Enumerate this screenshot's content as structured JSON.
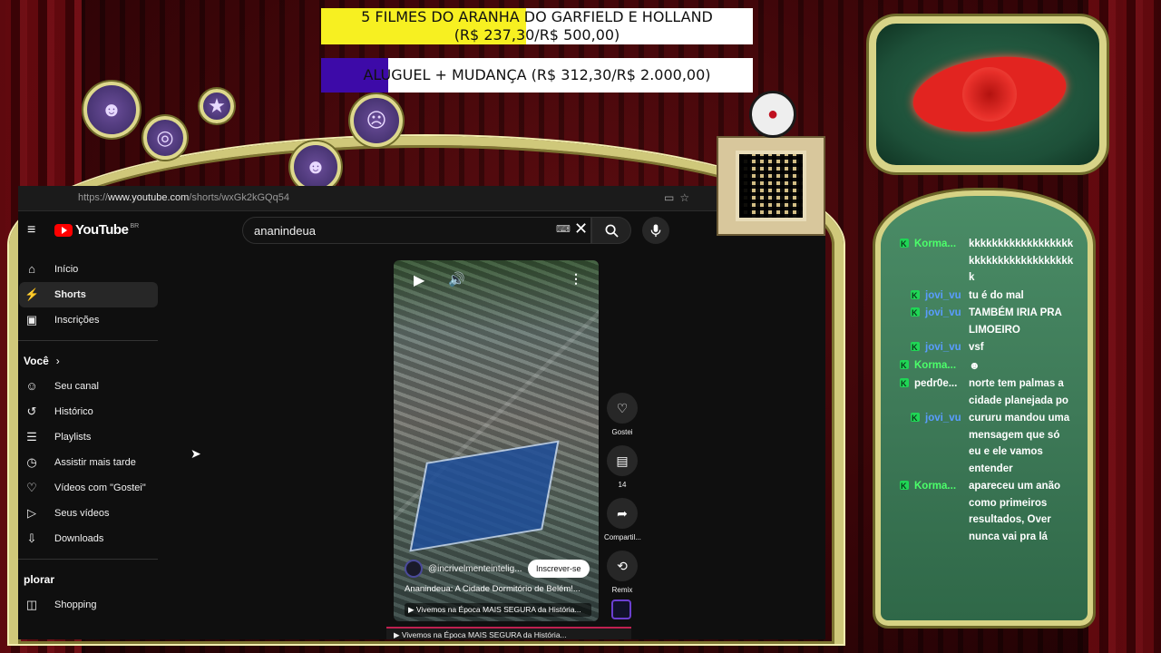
{
  "goals": [
    {
      "title": "5 FILMES DO ARANHA DO GARFIELD E HOLLAND",
      "progress": "(R$ 237,30/R$ 500,00)",
      "fill_fraction": 0.475,
      "color": "#f7f021"
    },
    {
      "title": "ALUGUEL + MUDANÇA (R$ 312,30/R$ 2.000,00)",
      "fill_fraction": 0.156,
      "color": "#3d0aa8"
    }
  ],
  "browser": {
    "url_prefix": "https://",
    "url_host": "www.youtube.com",
    "url_path": "/shorts/wxGk2kGQq54"
  },
  "youtube": {
    "logo_text": "YouTube",
    "region": "BR",
    "search_value": "ananindeua",
    "sidebar": {
      "items": [
        {
          "label": "Início",
          "icon": "home-icon",
          "active": false
        },
        {
          "label": "Shorts",
          "icon": "shorts-icon",
          "active": true
        },
        {
          "label": "Inscrições",
          "icon": "subscriptions-icon",
          "active": false
        }
      ],
      "section_you": "Você",
      "you_items": [
        {
          "label": "Seu canal",
          "icon": "channel-icon"
        },
        {
          "label": "Histórico",
          "icon": "history-icon"
        },
        {
          "label": "Playlists",
          "icon": "playlists-icon"
        },
        {
          "label": "Assistir mais tarde",
          "icon": "watch-later-icon"
        },
        {
          "label": "Vídeos com \"Gostei\"",
          "icon": "liked-icon"
        },
        {
          "label": "Seus vídeos",
          "icon": "your-videos-icon"
        },
        {
          "label": "Downloads",
          "icon": "downloads-icon"
        }
      ],
      "section_explore": "plorar",
      "explore_items": [
        {
          "label": "Shopping",
          "icon": "shopping-icon"
        }
      ]
    },
    "short": {
      "channel": "@incrivelmenteintelig...",
      "subscribe_label": "Inscrever-se",
      "title": "Ananindeua: A Cidade Dormitório de Belém!...",
      "related": "Vivemos na Época MAIS SEGURA da História...",
      "next_related": "Vivemos na Época MAIS SEGURA da História..."
    },
    "actions": {
      "like_label": "Gostei",
      "comments_count": "14",
      "share_label": "Compartil...",
      "remix_label": "Remix"
    }
  },
  "chat": [
    {
      "user": "Korma...",
      "color": "#4cff6a",
      "text": "kkkkkkkkkkkkkkkkkkkkkkkkkkkkkkkkkkkkk"
    },
    {
      "user": "jovi_vu",
      "color": "#5a9cff",
      "text": "tu é do mal"
    },
    {
      "user": "jovi_vu",
      "color": "#5a9cff",
      "text": "TAMBÉM IRIA PRA LIMOEIRO"
    },
    {
      "user": "jovi_vu",
      "color": "#5a9cff",
      "text": "vsf"
    },
    {
      "user": "Korma...",
      "color": "#4cff6a",
      "text": ""
    },
    {
      "user": "pedr0e...",
      "color": "#ffffff",
      "text": "norte tem palmas a cidade planejada po"
    },
    {
      "user": "jovi_vu",
      "color": "#5a9cff",
      "text": "cururu mandou uma mensagem que só eu e ele vamos entender"
    },
    {
      "user": "Korma...",
      "color": "#4cff6a",
      "text": "apareceu um anão como primeiros resultados, Over nunca vai pra lá"
    }
  ]
}
